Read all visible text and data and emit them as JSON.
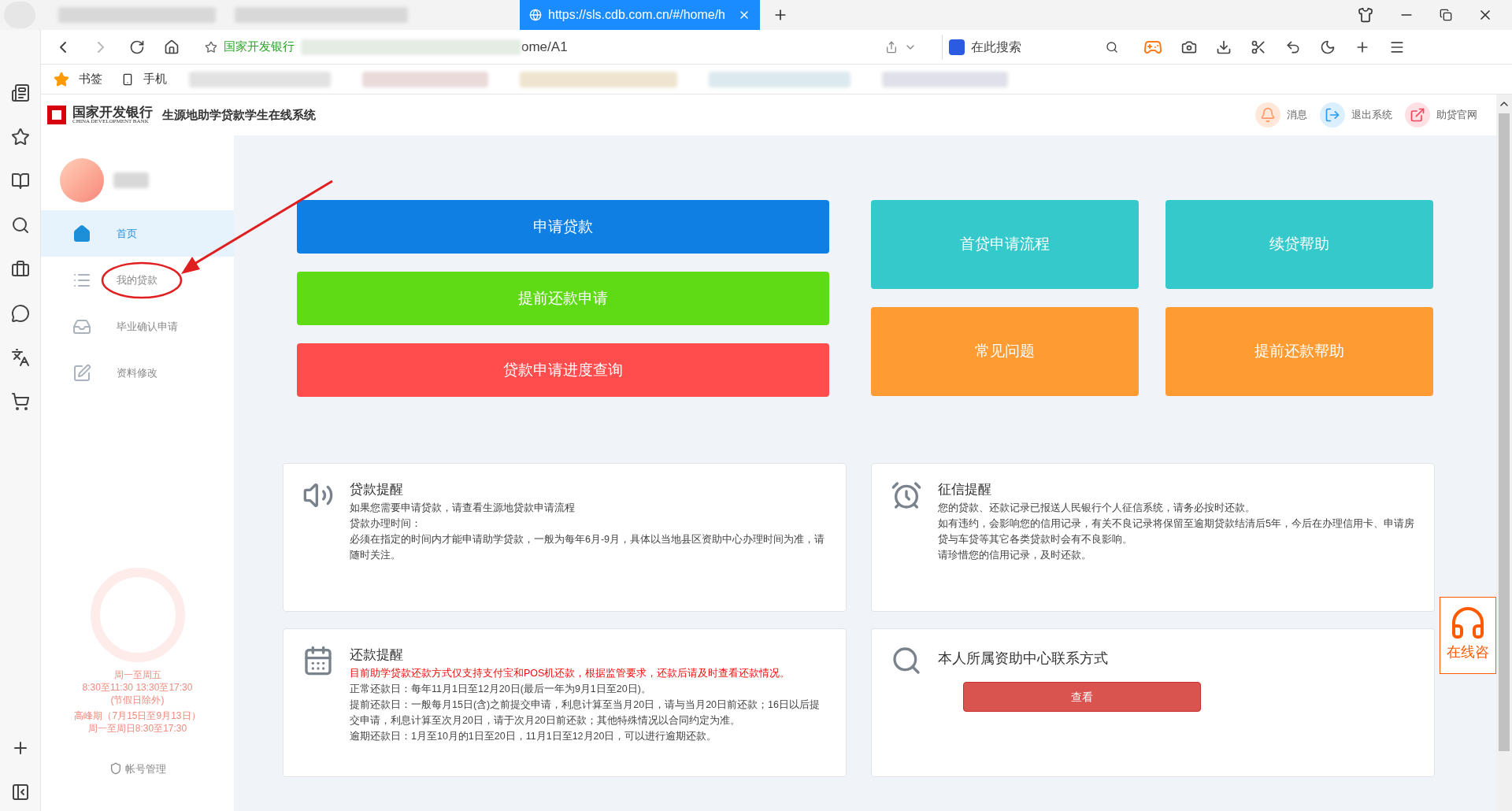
{
  "browser": {
    "active_tab": {
      "title": "https://sls.cdb.com.cn/#/home/h"
    },
    "address": {
      "site": "国家开发银行",
      "url_tail": "ome/A1"
    },
    "search": {
      "placeholder": "在此搜索"
    },
    "bookmarks": [
      "书签",
      "手机"
    ]
  },
  "header": {
    "bank_name": "国家开发银行",
    "bank_name_en": "CHINA DEVELOPMENT BANK",
    "system_title": "生源地助学贷款学生在线系统",
    "actions": [
      {
        "kind": "bell",
        "label": "消息"
      },
      {
        "kind": "exit",
        "label": "退出系统"
      },
      {
        "kind": "link",
        "label": "助贷官网"
      }
    ]
  },
  "sidebar": {
    "items": [
      {
        "kind": "home",
        "label": "首页",
        "selected": true
      },
      {
        "kind": "list",
        "label": "我的贷款",
        "selected": false
      },
      {
        "kind": "inbox",
        "label": "毕业确认申请",
        "selected": false
      },
      {
        "kind": "edit",
        "label": "资料修改",
        "selected": false
      }
    ],
    "hours": [
      "周一至周五",
      "8:30至11:30 13:30至17:30",
      "(节假日除外)",
      "高峰期（7月15日至9月13日）",
      "周一至周日8:30至17:30"
    ],
    "account": "帐号管理"
  },
  "actions": [
    {
      "label": "申请贷款",
      "color": "#0f7fe3"
    },
    {
      "label": "提前还款申请",
      "color": "#5fdb15"
    },
    {
      "label": "贷款申请进度查询",
      "color": "#ff4c4c"
    }
  ],
  "tiles": [
    {
      "label": "首贷申请流程",
      "color": "#36c9cb"
    },
    {
      "label": "续贷帮助",
      "color": "#36c9cb"
    },
    {
      "label": "常见问题",
      "color": "#ff9b33"
    },
    {
      "label": "提前还款帮助",
      "color": "#ff9b33"
    }
  ],
  "cards": [
    {
      "kind": "speaker",
      "title": "贷款提醒",
      "lines": [
        {
          "text": "如果您需要申请贷款，请查看生源地贷款申请流程",
          "alert": false
        },
        {
          "text": "贷款办理时间：",
          "alert": false
        },
        {
          "text": "必须在指定的时间内才能申请助学贷款，一般为每年6月-9月，具体以当地县区资助中心办理时间为准，请随时关注。",
          "alert": false
        }
      ]
    },
    {
      "kind": "alarm",
      "title": "征信提醒",
      "lines": [
        {
          "text": "您的贷款、还款记录已报送人民银行个人征信系统，请务必按时还款。",
          "alert": false
        },
        {
          "text": "如有违约，会影响您的信用记录，有关不良记录将保留至逾期贷款结清后5年，今后在办理信用卡、申请房贷与车贷等其它各类贷款时会有不良影响。",
          "alert": false
        },
        {
          "text": "请珍惜您的信用记录，及时还款。",
          "alert": false
        }
      ]
    },
    {
      "kind": "calendar",
      "title": "还款提醒",
      "lines": [
        {
          "text": "目前助学贷款还款方式仅支持支付宝和POS机还款，根据监管要求，还款后请及时查看还款情况。",
          "alert": true
        },
        {
          "text": "正常还款日：每年11月1日至12月20日(最后一年为9月1日至20日)。",
          "alert": false
        },
        {
          "text": "提前还款日：一般每月15日(含)之前提交申请，利息计算至当月20日，请与当月20日前还款；16日以后提交申请，利息计算至次月20日，请于次月20日前还款；其他特殊情况以合同约定为准。",
          "alert": false
        },
        {
          "text": "逾期还款日：1月至10月的1日至20日，11月1日至12月20日，可以进行逾期还款。",
          "alert": false
        }
      ]
    },
    {
      "kind": "search",
      "title": "本人所属资助中心联系方式",
      "button": "查看"
    }
  ],
  "float": {
    "label": "在线咨"
  }
}
